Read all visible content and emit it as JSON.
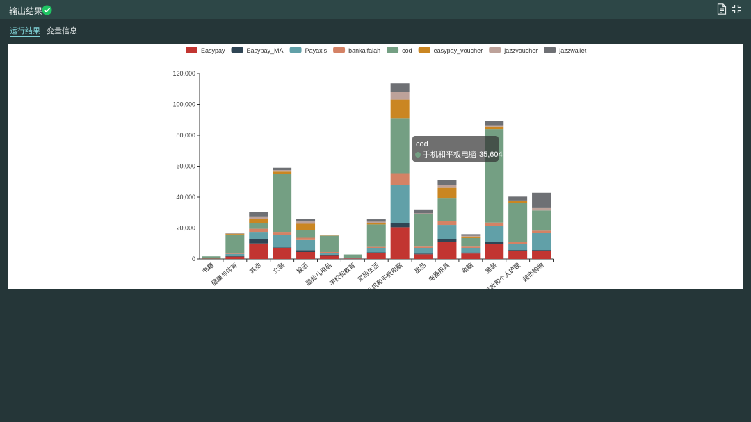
{
  "header": {
    "title": "输出结果",
    "status_icon": "check-circle-icon",
    "status_color": "#1fc463"
  },
  "tabs": [
    {
      "label": "运行结果"
    },
    {
      "label": "变量信息"
    }
  ],
  "chart_data": {
    "type": "bar",
    "stacked": true,
    "legend_position": "top",
    "categories": [
      "书籍",
      "健康与体育",
      "其他",
      "女装",
      "娱乐",
      "婴幼儿用品",
      "学校和教育",
      "家居生活",
      "手机和平板电脑",
      "甜品",
      "电器用具",
      "电脑",
      "男装",
      "美妆和个人护理",
      "超市购物"
    ],
    "ylim": [
      0,
      120000
    ],
    "yticks": [
      0,
      20000,
      40000,
      60000,
      80000,
      100000,
      120000
    ],
    "ytick_labels": [
      "0",
      "20,000",
      "40,000",
      "60,000",
      "80,000",
      "100,000",
      "120,000"
    ],
    "series": [
      {
        "name": "Easypay",
        "color": "#c23531",
        "values": [
          200,
          1500,
          10000,
          7000,
          4500,
          2000,
          300,
          3800,
          20500,
          3000,
          11000,
          3500,
          9500,
          5000,
          5000
        ]
      },
      {
        "name": "Easypay_MA",
        "color": "#2f4554",
        "values": [
          0,
          300,
          3000,
          500,
          1200,
          500,
          100,
          500,
          2500,
          500,
          2000,
          700,
          1500,
          800,
          800
        ]
      },
      {
        "name": "Payaxis",
        "color": "#61a0a8",
        "values": [
          0,
          1500,
          4500,
          8000,
          6500,
          1500,
          200,
          2500,
          25000,
          3500,
          9000,
          3000,
          10500,
          4000,
          11000
        ]
      },
      {
        "name": "bankalfalah",
        "color": "#d48265",
        "values": [
          0,
          500,
          2000,
          2000,
          1500,
          500,
          100,
          1000,
          7500,
          1000,
          2500,
          800,
          2000,
          1000,
          1500
        ]
      },
      {
        "name": "cod",
        "color": "#749f83",
        "values": [
          1500,
          12000,
          3500,
          37500,
          5000,
          10500,
          2200,
          14500,
          35604,
          21000,
          15000,
          5500,
          60500,
          25500,
          13000
        ]
      },
      {
        "name": "easypay_voucher",
        "color": "#ca8622",
        "values": [
          0,
          500,
          3000,
          1500,
          4000,
          200,
          0,
          1000,
          12000,
          0,
          6500,
          1000,
          1500,
          1000,
          0
        ]
      },
      {
        "name": "jazzvoucher",
        "color": "#bda29a",
        "values": [
          0,
          200,
          1500,
          1000,
          1500,
          200,
          0,
          800,
          5000,
          500,
          2000,
          500,
          1000,
          500,
          2000
        ]
      },
      {
        "name": "jazzwallet",
        "color": "#6e7074",
        "values": [
          0,
          500,
          3000,
          1500,
          1500,
          300,
          0,
          1500,
          5500,
          2500,
          3000,
          1000,
          2500,
          2500,
          9500
        ]
      }
    ],
    "tooltip": {
      "series": "cod",
      "category": "手机和平板电脑",
      "value_text": "35,604"
    }
  }
}
